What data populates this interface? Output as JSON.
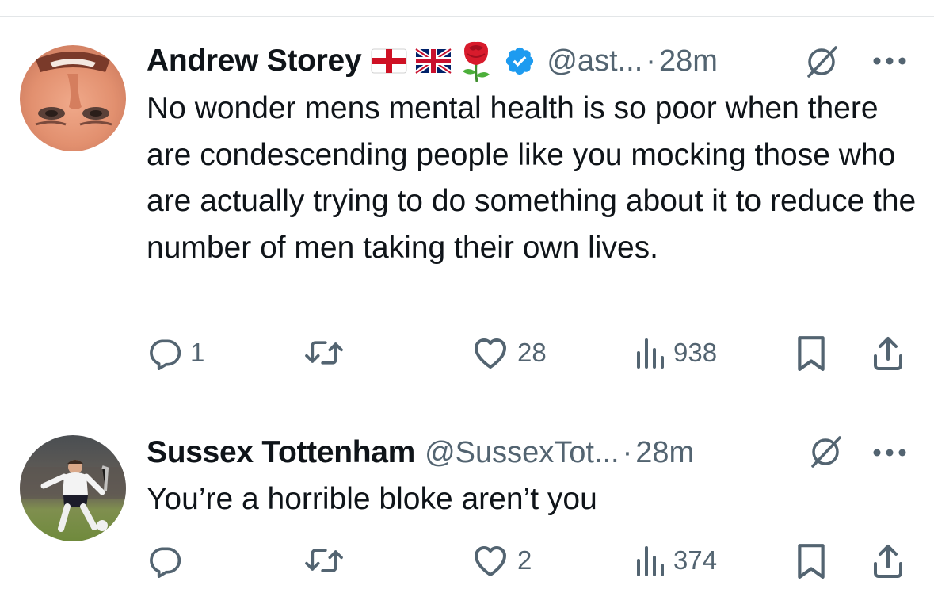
{
  "tweets": [
    {
      "author_name": "Andrew Storey",
      "emoji_badges": [
        "england-flag-emoji",
        "uk-flag-emoji",
        "red-rose-emoji"
      ],
      "verified": true,
      "handle": "@ast...",
      "separator": "·",
      "time": "28m",
      "text": "No wonder mens mental health is so poor when there are condescending people like you mocking those who are actually trying to do something about it to reduce the number of men taking their own lives.",
      "replies": "1",
      "retweets": "",
      "likes": "28",
      "views": "938"
    },
    {
      "author_name": "Sussex Tottenham",
      "handle": "@SussexTot...",
      "separator": "·",
      "time": "28m",
      "text": "You’re a horrible bloke aren’t you",
      "replies": "",
      "retweets": "",
      "likes": "2",
      "views": "374"
    }
  ],
  "colors": {
    "text": "#0f1419",
    "muted": "#536471",
    "verified_blue": "#1d9bf0",
    "divider": "#e3e6e8"
  }
}
